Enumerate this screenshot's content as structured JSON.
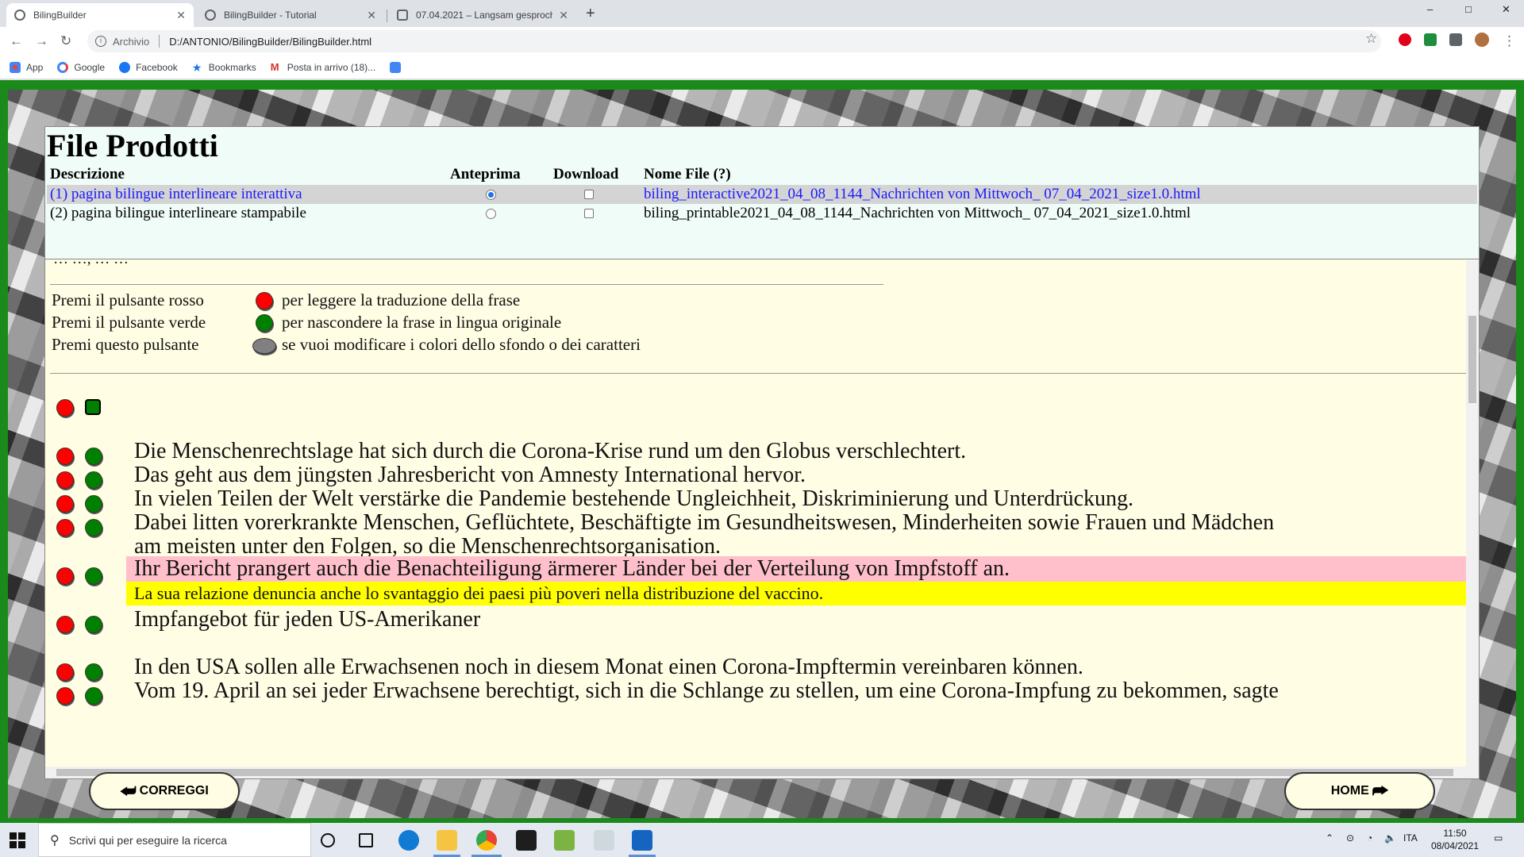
{
  "browser": {
    "tabs": [
      {
        "title": "BilingBuilder",
        "active": true
      },
      {
        "title": "BilingBuilder - Tutorial",
        "active": false
      },
      {
        "title": "07.04.2021 – Langsam gesproche",
        "active": false
      }
    ],
    "new_tab": "+",
    "window_controls": [
      "–",
      "□",
      "✕"
    ],
    "address": {
      "prefix": "Archivio",
      "url": "D:/ANTONIO/BilingBuilder/BilingBuilder.html"
    },
    "bookmarks": [
      {
        "label": "App",
        "icon": "apps-grid-icon"
      },
      {
        "label": "Google",
        "icon": "google-icon"
      },
      {
        "label": "Facebook",
        "icon": "facebook-icon"
      },
      {
        "label": "Bookmarks",
        "icon": "star-icon"
      },
      {
        "label": "Posta in arrivo (18)...",
        "icon": "gmail-icon"
      },
      {
        "label": "",
        "icon": "translate-icon"
      }
    ]
  },
  "files_panel": {
    "title": "File Prodotti",
    "headers": {
      "description": "Descrizione",
      "preview": "Anteprima",
      "download": "Download",
      "filename": "Nome File (?)"
    },
    "rows": [
      {
        "description": "(1) pagina bilingue interlineare interattiva",
        "preview_selected": true,
        "download_checked": false,
        "filename": "biling_interactive2021_04_08_1144_Nachrichten von Mittwoch_ 07_04_2021_size1.0.html"
      },
      {
        "description": "(2) pagina bilingue interlineare stampabile",
        "preview_selected": false,
        "download_checked": false,
        "filename": "biling_printable2021_04_08_1144_Nachrichten von Mittwoch_ 07_04_2021_size1.0.html"
      }
    ]
  },
  "reader": {
    "cutoff_text": "… …, … …",
    "legend": [
      {
        "label": "Premi il pulsante rosso",
        "button": "red",
        "text": "per leggere la traduzione della frase"
      },
      {
        "label": "Premi il pulsante verde",
        "button": "green",
        "text": "per nascondere la frase in lingua originale"
      },
      {
        "label": "Premi questo pulsante",
        "button": "gray",
        "text": "se vuoi modificare i colori dello sfondo o dei caratteri"
      }
    ],
    "sentences": [
      {
        "text": "Die Menschenrechtslage hat sich durch die Corona-Krise rund um den Globus verschlechtert."
      },
      {
        "text": "Das geht aus dem jüngsten Jahresbericht von Amnesty International hervor."
      },
      {
        "text": "In vielen Teilen der Welt verstärke die Pandemie bestehende Ungleichheit, Diskriminierung und Unterdrückung."
      },
      {
        "text": "Dabei litten vorerkrankte Menschen, Geflüchtete, Beschäftigte im Gesundheitswesen, Minderheiten sowie Frauen und Mädchen",
        "continuation": "am meisten unter den Folgen, so die Menschenrechtsorganisation."
      },
      {
        "text": "Ihr Bericht prangert auch die Benachteiligung ärmerer Länder bei der Verteilung von Impfstoff an.",
        "highlight": true,
        "translation": "La sua relazione denuncia anche lo svantaggio dei paesi più poveri nella distribuzione del vaccino."
      },
      {
        "text": "Impfangebot für jeden US-Amerikaner"
      },
      {
        "text": "In den USA sollen alle Erwachsenen noch in diesem Monat einen Corona-Impftermin vereinbaren können."
      },
      {
        "text": "Vom 19. April an sei jeder Erwachsene berechtigt, sich in die Schlange zu stellen, um eine Corona-Impfung zu bekommen, sagte"
      }
    ]
  },
  "page_buttons": {
    "left": {
      "label": "CORREGGI",
      "icon": "⮨"
    },
    "right": {
      "label": "HOME",
      "icon": "⮫"
    }
  },
  "taskbar": {
    "search_placeholder": "Scrivi qui per eseguire la ricerca",
    "tray_lang": "ITA",
    "time": "11:50",
    "date": "08/04/2021"
  },
  "colors": {
    "page_border": "#1a8a1a",
    "content_bg": "#fffde3",
    "files_bg": "#f0fcf8",
    "highlight": "#ffc0cb",
    "translation": "#ffff00",
    "selected_row_text": "#1a1aff"
  }
}
